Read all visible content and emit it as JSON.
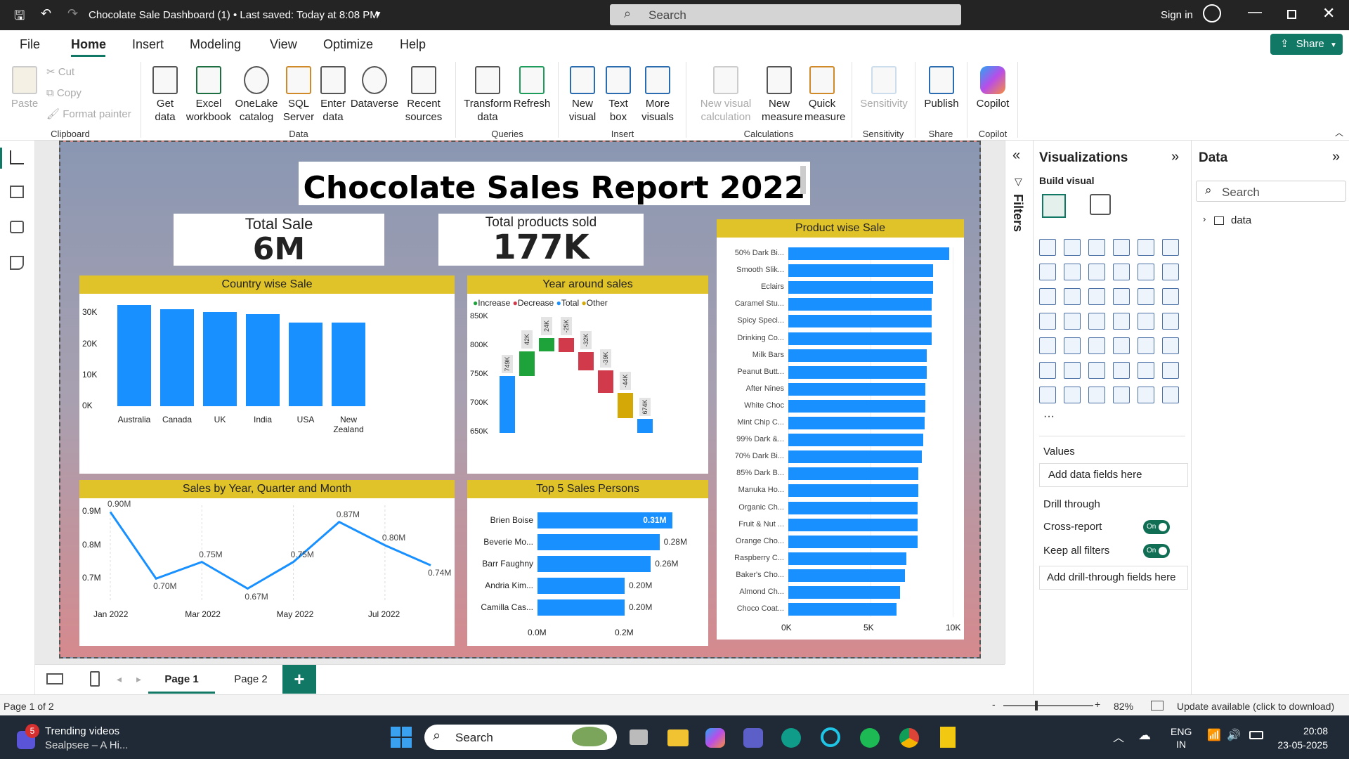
{
  "window": {
    "title": "Chocolate Sale Dashboard (1) • Last saved: Today at 8:08 PM",
    "search_placeholder": "Search",
    "sign_in": "Sign in"
  },
  "menu": [
    "File",
    "Home",
    "Insert",
    "Modeling",
    "View",
    "Optimize",
    "Help"
  ],
  "share_label": "Share",
  "ribbon": {
    "clipboard": {
      "paste": "Paste",
      "cut": "Cut",
      "copy": "Copy",
      "format_painter": "Format painter",
      "group": "Clipboard"
    },
    "data": {
      "get_data": "Get data",
      "excel": "Excel workbook",
      "onelake": "OneLake catalog",
      "sql": "SQL Server",
      "enter": "Enter data",
      "dataverse": "Dataverse",
      "recent": "Recent sources",
      "group": "Data"
    },
    "queries": {
      "transform": "Transform data",
      "refresh": "Refresh",
      "group": "Queries"
    },
    "insert": {
      "new_visual": "New visual",
      "text_box": "Text box",
      "more_visuals": "More visuals",
      "group": "Insert"
    },
    "calculations": {
      "new_visual_calc": "New visual calculation",
      "new_measure": "New measure",
      "quick_measure": "Quick measure",
      "group": "Calculations"
    },
    "sensitivity": {
      "label": "Sensitivity",
      "group": "Sensitivity"
    },
    "share": {
      "publish": "Publish",
      "group": "Share"
    },
    "copilot": {
      "label": "Copilot",
      "group": "Copilot"
    }
  },
  "report": {
    "title": "Chocolate Sales Report 2022",
    "kpi1": {
      "label": "Total Sale",
      "value": "6M"
    },
    "kpi2": {
      "label": "Total products sold",
      "value": "177K"
    },
    "country_title": "Country wise Sale",
    "waterfall_title": "Year around sales",
    "waterfall_legend": [
      "Increase",
      "Decrease",
      "Total",
      "Other"
    ],
    "line_title": "Sales by Year, Quarter and Month",
    "top5_title": "Top 5 Sales Persons",
    "product_title": "Product wise Sale"
  },
  "chart_data": [
    {
      "type": "bar",
      "title": "Country wise Sale",
      "categories": [
        "Australia",
        "Canada",
        "UK",
        "India",
        "USA",
        "New Zealand"
      ],
      "values": [
        32.5,
        31.2,
        30.2,
        29.5,
        27,
        26.8
      ],
      "yticks": [
        "30K",
        "20K",
        "10K",
        "0K"
      ],
      "ylim": [
        0,
        33
      ]
    },
    {
      "type": "bar",
      "title": "Year around sales",
      "subtype": "waterfall",
      "yticks": [
        "850K",
        "800K",
        "750K",
        "700K",
        "650K"
      ],
      "ylim": [
        650,
        850
      ],
      "steps": [
        {
          "label": "749K",
          "start": 650,
          "end": 749,
          "kind": "Total"
        },
        {
          "label": "42K",
          "start": 749,
          "end": 791,
          "kind": "Increase"
        },
        {
          "label": "24K",
          "start": 791,
          "end": 815,
          "kind": "Increase"
        },
        {
          "label": "-25K",
          "start": 815,
          "end": 790,
          "kind": "Decrease"
        },
        {
          "label": "-32K",
          "start": 790,
          "end": 758,
          "kind": "Decrease"
        },
        {
          "label": "-39K",
          "start": 758,
          "end": 719,
          "kind": "Decrease"
        },
        {
          "label": "-44K",
          "start": 719,
          "end": 675,
          "kind": "Other"
        },
        {
          "label": "674K",
          "start": 650,
          "end": 674,
          "kind": "Total"
        }
      ],
      "colors": {
        "Increase": "#1ea33a",
        "Decrease": "#d13a4b",
        "Total": "#1890ff",
        "Other": "#d4a807"
      }
    },
    {
      "type": "line",
      "title": "Sales by Year, Quarter and Month",
      "x": [
        "Jan 2022",
        "Feb 2022",
        "Mar 2022",
        "Apr 2022",
        "May 2022",
        "Jun 2022",
        "Jul 2022",
        "Aug 2022"
      ],
      "values": [
        0.9,
        0.7,
        0.75,
        0.67,
        0.75,
        0.87,
        0.8,
        0.74
      ],
      "labels": [
        "0.90M",
        "0.70M",
        "0.75M",
        "0.67M",
        "0.75M",
        "0.87M",
        "0.80M",
        "0.74M"
      ],
      "xticks": [
        "Jan 2022",
        "Mar 2022",
        "May 2022",
        "Jul 2022"
      ],
      "yticks": [
        "0.9M",
        "0.8M",
        "0.7M"
      ],
      "ylim": [
        0.65,
        0.92
      ]
    },
    {
      "type": "bar",
      "title": "Top 5 Sales Persons",
      "orientation": "horizontal",
      "categories": [
        "Brien Boise",
        "Beverie Mo...",
        "Barr Faughny",
        "Andria Kim...",
        "Camilla Cas..."
      ],
      "values": [
        0.31,
        0.28,
        0.26,
        0.2,
        0.2
      ],
      "labels": [
        "0.31M",
        "0.28M",
        "0.26M",
        "0.20M",
        "0.20M"
      ],
      "xticks": [
        "0.0M",
        "0.2M"
      ],
      "xlim": [
        0,
        0.4
      ]
    },
    {
      "type": "bar",
      "title": "Product wise Sale",
      "orientation": "horizontal",
      "categories": [
        "50% Dark Bi...",
        "Smooth Slik...",
        "Eclairs",
        "Caramel Stu...",
        "Spicy Speci...",
        "Drinking Co...",
        "Milk Bars",
        "Peanut Butt...",
        "After Nines",
        "White Choc",
        "Mint Chip C...",
        "99% Dark &...",
        "70% Dark Bi...",
        "85% Dark B...",
        "Manuka Ho...",
        "Organic Ch...",
        "Fruit & Nut ...",
        "Orange Cho...",
        "Raspberry C...",
        "Baker's Cho...",
        "Almond Ch...",
        "Choco Coat..."
      ],
      "values": [
        9.8,
        8.8,
        8.8,
        8.7,
        8.7,
        8.7,
        8.4,
        8.4,
        8.35,
        8.35,
        8.3,
        8.2,
        8.1,
        7.9,
        7.9,
        7.85,
        7.85,
        7.85,
        7.2,
        7.1,
        6.8,
        6.6
      ],
      "xticks": [
        "0K",
        "5K",
        "10K"
      ],
      "xlim": [
        0,
        10
      ]
    }
  ],
  "filters_label": "Filters",
  "viz_pane": {
    "title": "Visualizations",
    "build": "Build visual",
    "values": "Values",
    "add_data": "Add data fields here",
    "drill": "Drill through",
    "cross": "Cross-report",
    "keep": "Keep all filters",
    "toggle_on": "On",
    "add_drill": "Add drill-through fields here",
    "more": "···"
  },
  "data_pane": {
    "title": "Data",
    "search": "Search",
    "table": "data"
  },
  "pages": {
    "p1": "Page 1",
    "p2": "Page 2",
    "add": "+"
  },
  "status": {
    "page": "Page 1 of 2",
    "zoom": "82%",
    "update": "Update available (click to download)"
  },
  "taskbar": {
    "notif": "5",
    "trending": "Trending videos",
    "sub": "Sealpsee – A Hi...",
    "search": "Search",
    "lang": "ENG",
    "lang2": "IN",
    "time": "20:08",
    "date": "23-05-2025"
  }
}
